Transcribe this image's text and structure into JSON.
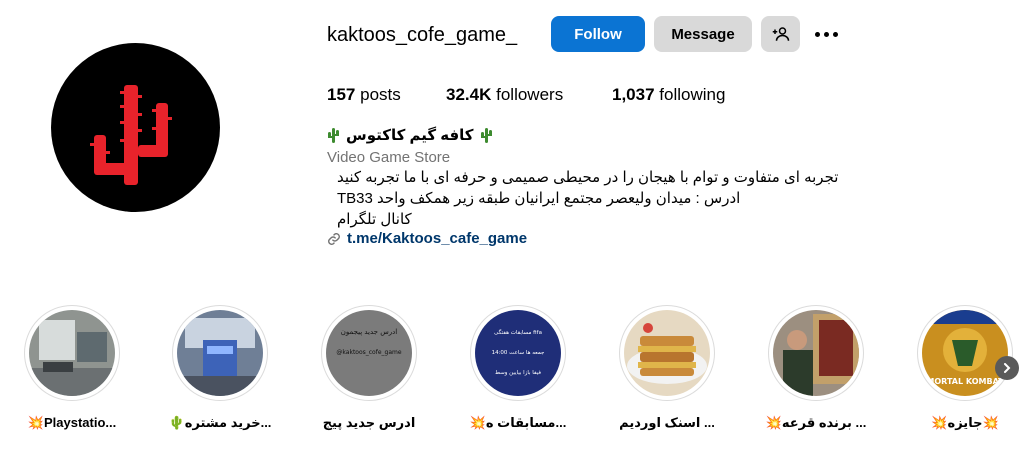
{
  "profile": {
    "username": "kaktoos_cofe_game_",
    "follow_label": "Follow",
    "message_label": "Message",
    "colors": {
      "follow": "#0b74d3",
      "avatar_bg": "#000000",
      "cactus": "#e8232b",
      "link": "#00376b"
    }
  },
  "stats": {
    "posts_count": "157",
    "posts_label": "posts",
    "followers_count": "32.4K",
    "followers_label": "followers",
    "following_count": "1,037",
    "following_label": "following"
  },
  "bio": {
    "name": "کافه گیم کاکتوس",
    "category": "Video Game Store",
    "lines": [
      "تجربه ای متفاوت و توام با هیجان را در محیطی صمیمی و حرفه ای با ما تجربه کنید",
      "ادرس : میدان ولیعصر مجتمع ایرانیان طبقه زیر همکف واحد TB33",
      "کانال تلگرام"
    ],
    "link": "t.me/Kaktoos_cafe_game"
  },
  "highlights": [
    {
      "label": "💥Playstatio...",
      "thumb_text": ""
    },
    {
      "label": "🌵خرید مشتره...",
      "thumb_text": ""
    },
    {
      "label": "ادرس جدید پیج",
      "thumb_text": "ادرس جدید پیجمون\n@kaktoos_cofe_game"
    },
    {
      "label": "💥مسابقات ه...",
      "thumb_text": "مسابقات هفتگی fifa\nجمعه ها ساعت 14:00\nفیفا بازا بیایین وسط"
    },
    {
      "label": "اسنک اوردیم ...",
      "thumb_text": ""
    },
    {
      "label": "💥برنده قرعه ...",
      "thumb_text": ""
    },
    {
      "label": "💥جایزه💥",
      "thumb_text": "MORTAL KOMBAT"
    }
  ]
}
